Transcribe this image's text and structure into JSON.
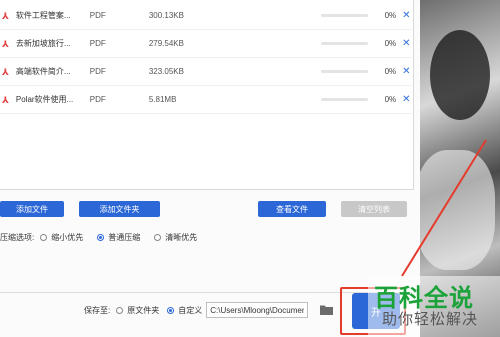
{
  "files": [
    {
      "name": "软件工程管案...",
      "type": "PDF",
      "size": "300.13KB",
      "progress": "0%",
      "progress_value": 0
    },
    {
      "name": "去新加坡旅行...",
      "type": "PDF",
      "size": "279.54KB",
      "progress": "0%",
      "progress_value": 0
    },
    {
      "name": "高端软件简介...",
      "type": "PDF",
      "size": "323.05KB",
      "progress": "0%",
      "progress_value": 0
    },
    {
      "name": "Polar软件使用...",
      "type": "PDF",
      "size": "5.81MB",
      "progress": "0%",
      "progress_value": 0
    }
  ],
  "buttons": {
    "add_file": "添加文件",
    "add_folder": "添加文件夹",
    "view_file": "查看文件",
    "clear_list": "清空列表"
  },
  "compression": {
    "label": "压缩选项:",
    "options": [
      "缩小优先",
      "普通压缩",
      "清晰优先"
    ],
    "selected": "普通压缩"
  },
  "save": {
    "label": "保存至:",
    "options": [
      "原文件夹",
      "自定义"
    ],
    "selected": "自定义",
    "path_value": "C:\\Users\\Mloong\\Documents"
  },
  "start_button_label": "开",
  "watermark": {
    "title": "百科全说",
    "subtitle": "助你轻松解决"
  },
  "colors": {
    "accent": "#2b67d6",
    "highlight": "#e53b2c",
    "pdf_icon": "#e04040",
    "watermark_green": "#1ba33a"
  }
}
